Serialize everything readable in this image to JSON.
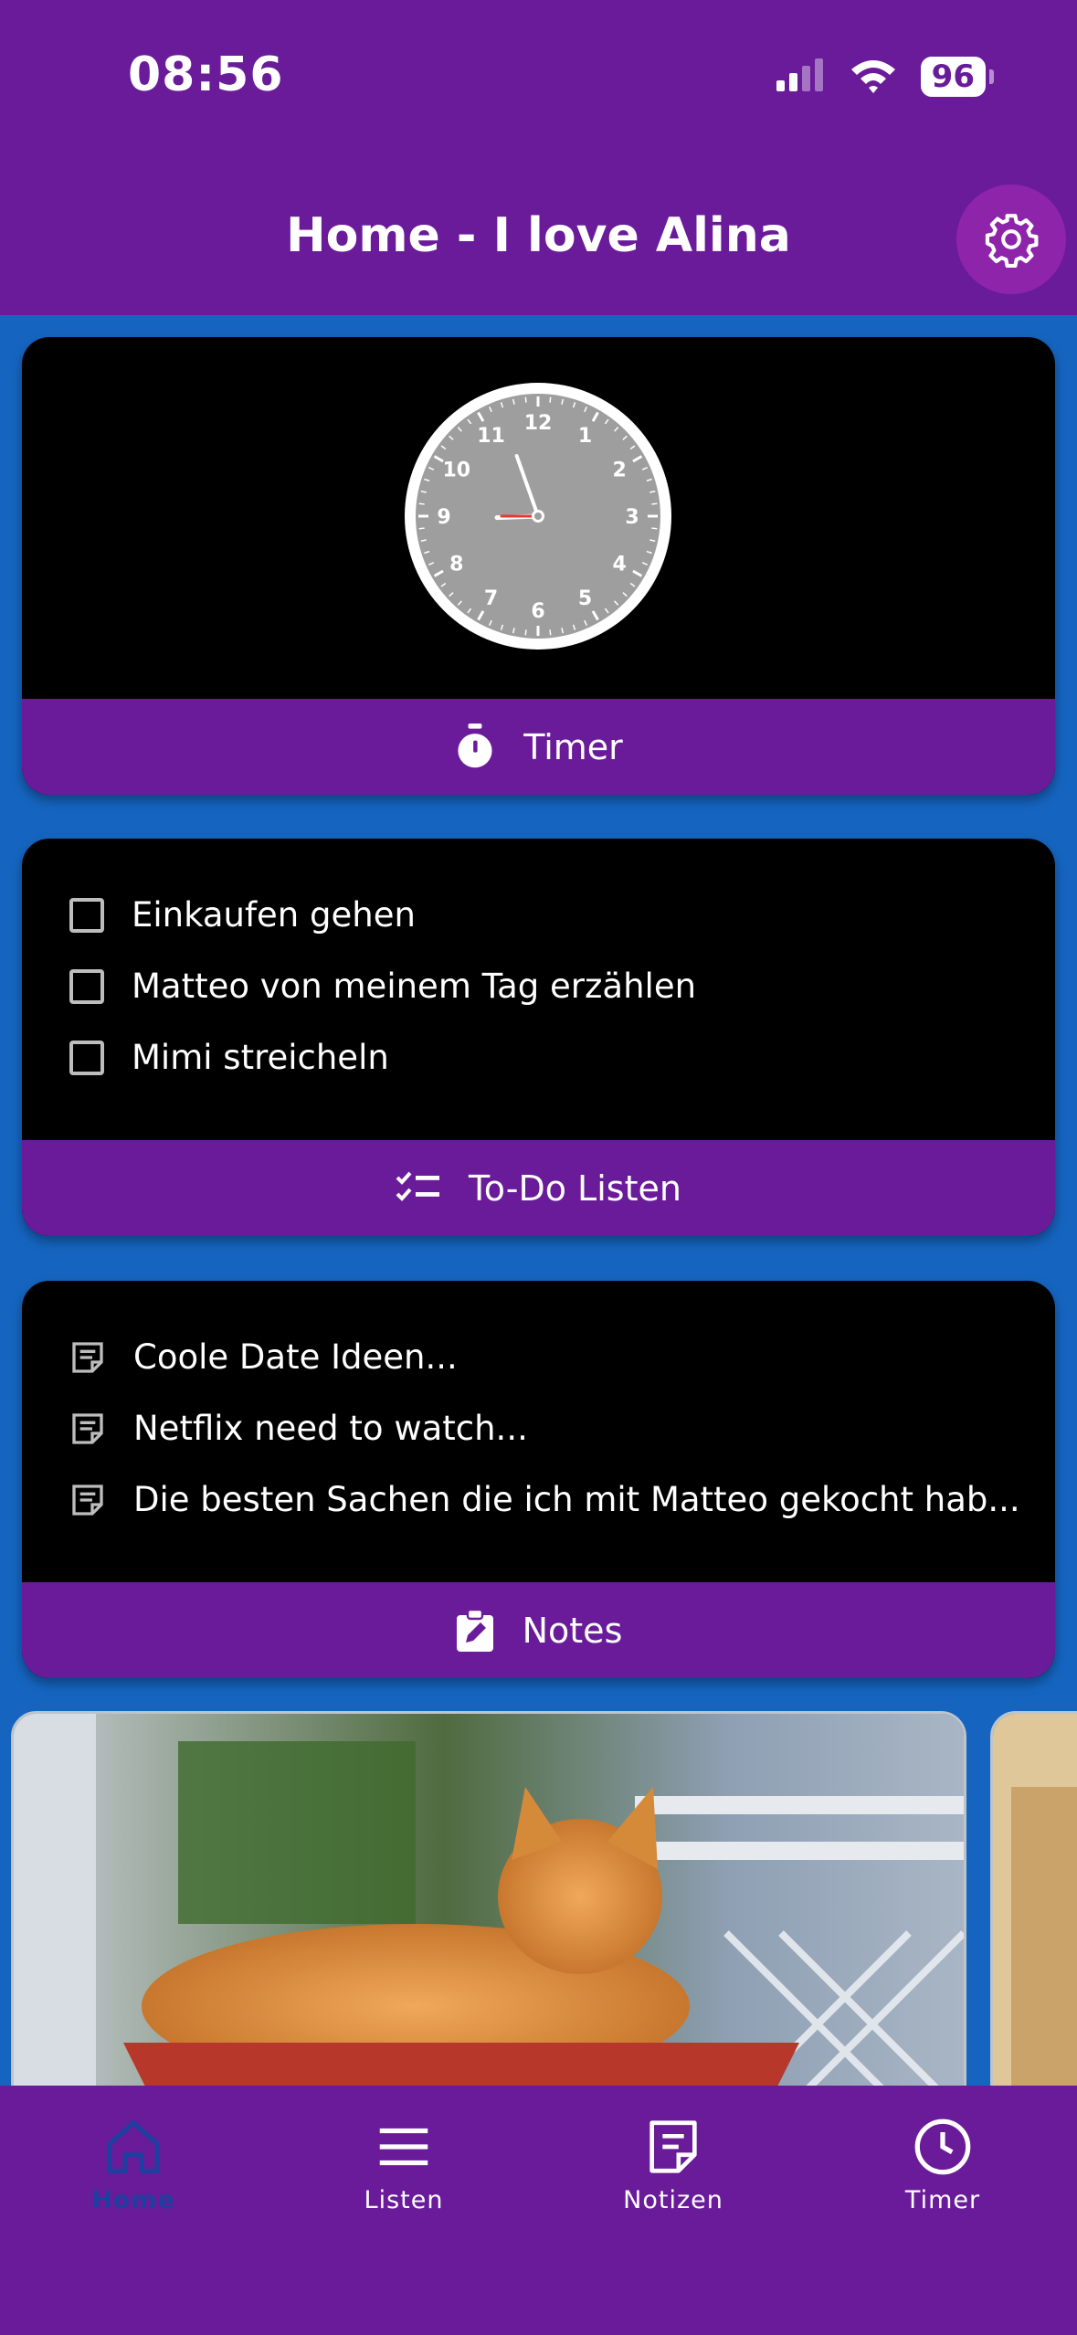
{
  "status_bar": {
    "time": "08:56",
    "battery": "96"
  },
  "header": {
    "title": "Home - I love Alina",
    "settings_icon": "gear-icon"
  },
  "timer_card": {
    "footer_label": "Timer",
    "footer_icon": "stopwatch-icon",
    "clock": {
      "numbers": [
        "12",
        "1",
        "2",
        "3",
        "4",
        "5",
        "6",
        "7",
        "8",
        "9",
        "10",
        "11"
      ],
      "hour": 8,
      "minute": 56,
      "second": 45
    }
  },
  "todo_card": {
    "items": [
      {
        "label": "Einkaufen gehen",
        "checked": false
      },
      {
        "label": "Matteo von meinem Tag erzählen",
        "checked": false
      },
      {
        "label": "Mimi streicheln",
        "checked": false
      }
    ],
    "footer_label": "To-Do Listen",
    "footer_icon": "checklist-icon"
  },
  "notes_card": {
    "items": [
      {
        "label": "Coole Date Ideen..."
      },
      {
        "label": "Netflix need to watch..."
      },
      {
        "label": "Die besten Sachen die ich mit Matteo gekocht hab..."
      }
    ],
    "footer_label": "Notes",
    "footer_icon": "edit-note-icon"
  },
  "bottom_nav": {
    "items": [
      {
        "label": "Home",
        "icon": "home-icon",
        "active": true
      },
      {
        "label": "Listen",
        "icon": "menu-icon",
        "active": false
      },
      {
        "label": "Notizen",
        "icon": "note-icon",
        "active": false
      },
      {
        "label": "Timer",
        "icon": "clock-icon",
        "active": false
      }
    ]
  },
  "colors": {
    "primary": "#6a1b9a",
    "background": "#1565c0",
    "active_nav": "#1e3fa0"
  }
}
